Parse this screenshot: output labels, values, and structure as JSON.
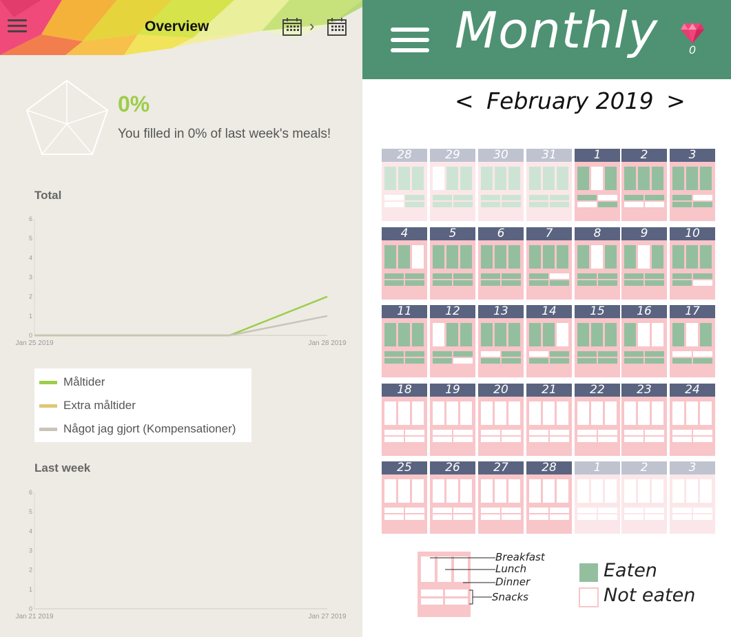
{
  "left": {
    "title": "Overview",
    "percent": "0%",
    "filled_text": "You filled in 0% of last week's meals!",
    "total_title": "Total",
    "lastweek_title": "Last week",
    "legend": [
      {
        "label": "Måltider",
        "color": "#9dcd4a"
      },
      {
        "label": "Extra måltider",
        "color": "#ddc878"
      },
      {
        "label": "Något jag gjort (Kompensationer)",
        "color": "#c9c3b8"
      }
    ],
    "total_chart": {
      "type": "line",
      "x_labels": [
        "Jan 25 2019",
        "Jan 28 2019"
      ],
      "y_ticks": [
        "0",
        "1",
        "2",
        "3",
        "4",
        "5",
        "6"
      ],
      "ylim": [
        0,
        6
      ],
      "series": [
        {
          "name": "Måltider",
          "x": [
            "Jan 25 2019",
            "Jan 27 2019",
            "Jan 28 2019"
          ],
          "values": [
            0,
            0,
            2
          ]
        },
        {
          "name": "Något jag gjort (Kompensationer)",
          "x": [
            "Jan 25 2019",
            "Jan 27 2019",
            "Jan 28 2019"
          ],
          "values": [
            0,
            0,
            1
          ]
        }
      ]
    },
    "lastweek_chart": {
      "type": "line",
      "x_labels": [
        "Jan 21 2019",
        "Jan 27 2019"
      ],
      "y_ticks": [
        "0",
        "1",
        "2",
        "3",
        "4",
        "5",
        "6"
      ],
      "ylim": [
        0,
        6
      ],
      "series": []
    }
  },
  "right": {
    "title": "Monthly",
    "gem_count": "0",
    "month_label": "February 2019",
    "prev_arrow": "<",
    "next_arrow": ">",
    "colors": {
      "header": "#4e9273",
      "day_head_active": "#5a6480",
      "day_head_inactive": "#bfc3d0",
      "body_active": "#f8c5c9",
      "body_inactive": "#fbe7e9",
      "eaten": "#93bf9f",
      "eaten_inactive": "#cde4d4",
      "not_eaten": "#ffffff"
    },
    "weeks": [
      [
        {
          "d": "28",
          "out": true,
          "m": "EEE",
          "s": "NENE"
        },
        {
          "d": "29",
          "out": true,
          "m": "NEE",
          "s": "EEEE"
        },
        {
          "d": "30",
          "out": true,
          "m": "EEE",
          "s": "EEEE"
        },
        {
          "d": "31",
          "out": true,
          "m": "EEE",
          "s": "EEEE"
        },
        {
          "d": "1",
          "out": false,
          "m": "ENE",
          "s": "ENNE"
        },
        {
          "d": "2",
          "out": false,
          "m": "EEE",
          "s": "EENN"
        },
        {
          "d": "3",
          "out": false,
          "m": "EEE",
          "s": "ENEE"
        }
      ],
      [
        {
          "d": "4",
          "out": false,
          "m": "EEN",
          "s": "EEEE"
        },
        {
          "d": "5",
          "out": false,
          "m": "EEE",
          "s": "EEEE"
        },
        {
          "d": "6",
          "out": false,
          "m": "EEE",
          "s": "EEEE"
        },
        {
          "d": "7",
          "out": false,
          "m": "EEE",
          "s": "ENEE"
        },
        {
          "d": "8",
          "out": false,
          "m": "ENE",
          "s": "EEEE"
        },
        {
          "d": "9",
          "out": false,
          "m": "ENE",
          "s": "EEEE"
        },
        {
          "d": "10",
          "out": false,
          "m": "EEE",
          "s": "EEEN"
        }
      ],
      [
        {
          "d": "11",
          "out": false,
          "m": "EEE",
          "s": "EEEE"
        },
        {
          "d": "12",
          "out": false,
          "m": "NEE",
          "s": "EEEN"
        },
        {
          "d": "13",
          "out": false,
          "m": "EEE",
          "s": "NEEE"
        },
        {
          "d": "14",
          "out": false,
          "m": "EEN",
          "s": "NEEE"
        },
        {
          "d": "15",
          "out": false,
          "m": "EEE",
          "s": "EEEE"
        },
        {
          "d": "16",
          "out": false,
          "m": "ENN",
          "s": "EEEE"
        },
        {
          "d": "17",
          "out": false,
          "m": "ENE",
          "s": "NNEE"
        }
      ],
      [
        {
          "d": "18",
          "out": false,
          "m": "NNN",
          "s": "NNNN"
        },
        {
          "d": "19",
          "out": false,
          "m": "NNN",
          "s": "NNNN"
        },
        {
          "d": "20",
          "out": false,
          "m": "NNN",
          "s": "NNNN"
        },
        {
          "d": "21",
          "out": false,
          "m": "NNN",
          "s": "NNNN"
        },
        {
          "d": "22",
          "out": false,
          "m": "NNN",
          "s": "NNNN"
        },
        {
          "d": "23",
          "out": false,
          "m": "NNN",
          "s": "NNNN"
        },
        {
          "d": "24",
          "out": false,
          "m": "NNN",
          "s": "NNNN"
        }
      ],
      [
        {
          "d": "25",
          "out": false,
          "m": "NNN",
          "s": "NNNN"
        },
        {
          "d": "26",
          "out": false,
          "m": "NNN",
          "s": "NNNN"
        },
        {
          "d": "27",
          "out": false,
          "m": "NNN",
          "s": "NNNN"
        },
        {
          "d": "28",
          "out": false,
          "m": "NNN",
          "s": "NNNN"
        },
        {
          "d": "1",
          "out": true,
          "m": "NNN",
          "s": "NNNN"
        },
        {
          "d": "2",
          "out": true,
          "m": "NNN",
          "s": "NNNN"
        },
        {
          "d": "3",
          "out": true,
          "m": "NNN",
          "s": "NNNN"
        }
      ]
    ],
    "legend_labels": {
      "breakfast": "Breakfast",
      "lunch": "Lunch",
      "dinner": "Dinner",
      "snacks": "Snacks",
      "eaten": "Eaten",
      "not_eaten": "Not eaten"
    }
  }
}
